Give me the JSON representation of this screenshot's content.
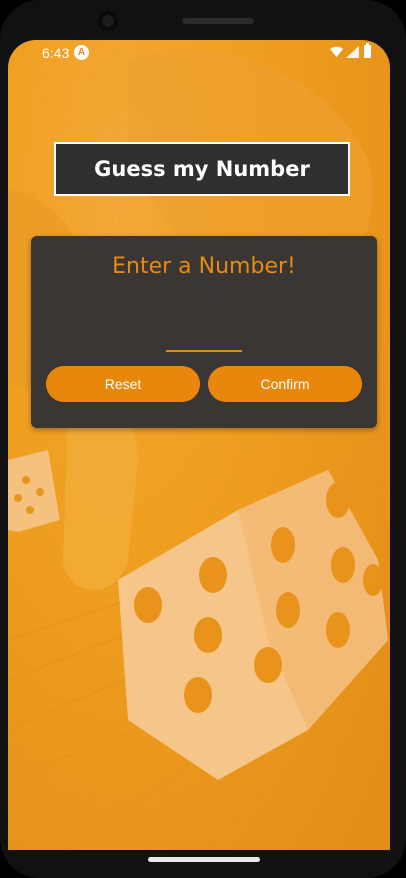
{
  "status_bar": {
    "time": "6:43",
    "app_badge": "A",
    "icons": [
      "wifi-icon",
      "signal-icon",
      "battery-icon"
    ]
  },
  "header": {
    "title": "Guess my Number"
  },
  "card": {
    "heading": "Enter a Number!",
    "input_value": "",
    "reset_label": "Reset",
    "confirm_label": "Confirm"
  },
  "colors": {
    "background": "#f0a020",
    "accent": "#e9870d",
    "card": "#3a3633",
    "title_box": "#2f2f2f"
  }
}
